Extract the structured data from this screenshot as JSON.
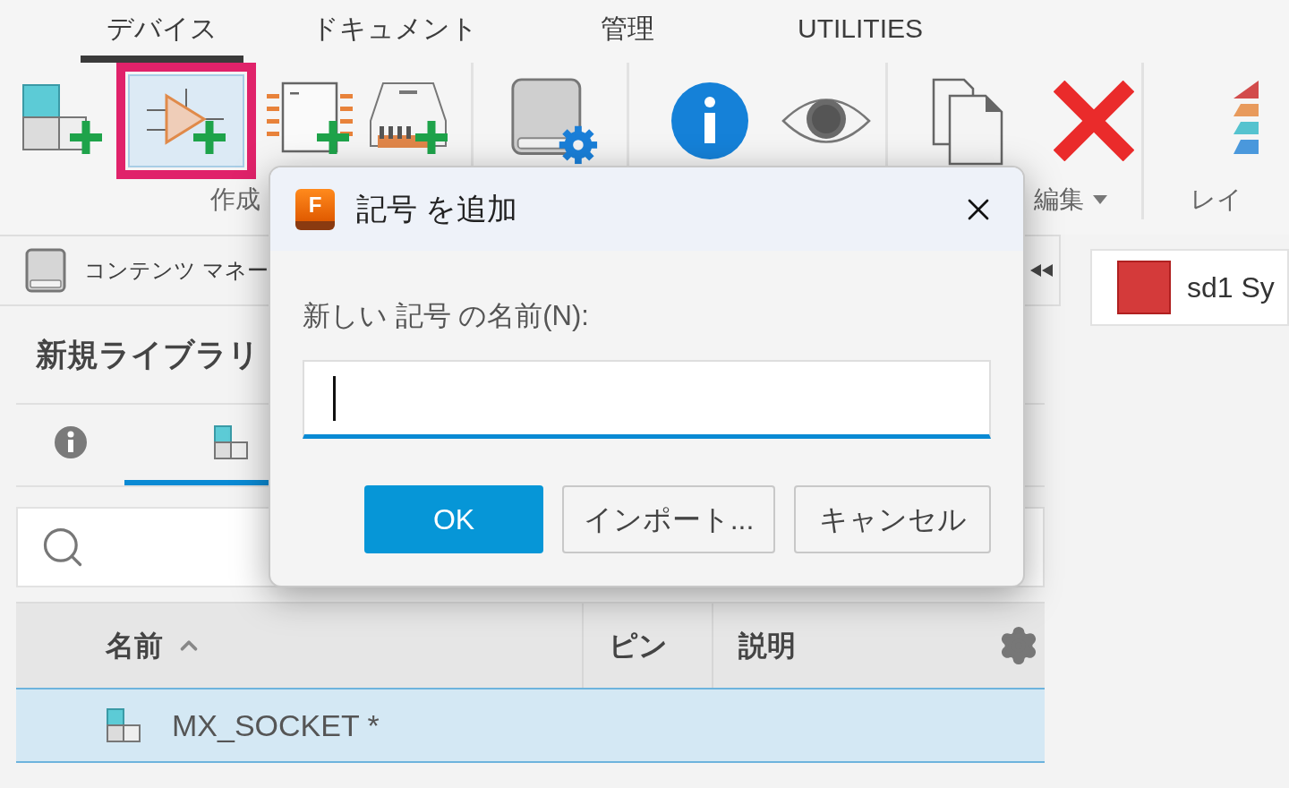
{
  "ribbon": {
    "tabs": [
      {
        "label": "デバイス",
        "selected": true
      },
      {
        "label": "ドキュメント",
        "selected": false
      },
      {
        "label": "管理",
        "selected": false
      },
      {
        "label": "UTILITIES",
        "selected": false
      }
    ],
    "groups": [
      {
        "label": "作成",
        "menu": false,
        "tools": [
          {
            "selected": false,
            "highlighted": false
          },
          {
            "selected": true,
            "highlighted": true
          },
          {
            "selected": false,
            "highlighted": false
          },
          {
            "selected": false,
            "highlighted": false
          }
        ]
      },
      {
        "tools": [
          {
            "selected": false,
            "highlighted": false
          }
        ]
      },
      {
        "tools": [
          {
            "selected": false,
            "highlighted": false
          },
          {
            "selected": false,
            "highlighted": false
          }
        ]
      },
      {
        "label": "編集",
        "menu": true,
        "tools": [
          {
            "selected": false,
            "highlighted": false
          },
          {
            "selected": false,
            "highlighted": false
          }
        ]
      },
      {
        "label": "レイ",
        "menu": false,
        "tools": [
          {
            "selected": false,
            "highlighted": false
          }
        ]
      }
    ]
  },
  "content_manager": {
    "title": "コンテンツ マネー",
    "library": "新規ライブラリ",
    "tabs": [
      {
        "selected": false
      },
      {
        "selected": true
      }
    ],
    "table": {
      "columns": [
        {
          "label": "名前",
          "sorted": true
        },
        {
          "label": "ピン",
          "sorted": false
        },
        {
          "label": "説明",
          "sorted": false
        }
      ],
      "rows": [
        {
          "name": "MX_SOCKET *",
          "selected": true
        }
      ]
    }
  },
  "sheet": {
    "label": "sd1 Sy",
    "color": "#d43a3a"
  },
  "dialog": {
    "logo": "F",
    "title": "記号 を追加",
    "field": {
      "label": "新しい 記号 の名前(N):",
      "focused": true
    },
    "buttons": [
      {
        "label": "OK",
        "primary": true
      },
      {
        "label": "インポート...",
        "primary": false
      },
      {
        "label": "キャンセル",
        "primary": false
      }
    ]
  }
}
